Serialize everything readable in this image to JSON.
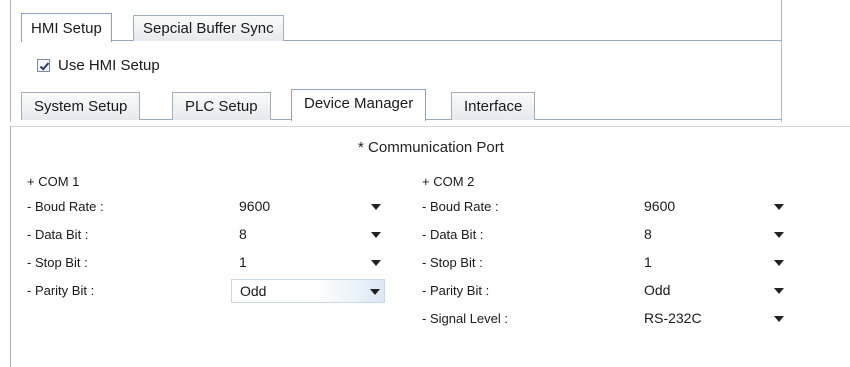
{
  "outer_tabs": [
    {
      "label": "HMI Setup",
      "active": true
    },
    {
      "label": "Sepcial Buffer Sync",
      "active": false
    }
  ],
  "use_hmi_setup": {
    "label": "Use HMI Setup",
    "checked": true
  },
  "inner_tabs": [
    {
      "label": "System Setup",
      "active": false
    },
    {
      "label": "PLC Setup",
      "active": false
    },
    {
      "label": "Device Manager",
      "active": true
    },
    {
      "label": "Interface",
      "active": false
    }
  ],
  "comm_port": {
    "title": "* Communication Port",
    "com1": {
      "header": "+ COM 1",
      "fields": [
        {
          "label": "- Boud Rate :",
          "value": "9600"
        },
        {
          "label": "- Data Bit :",
          "value": "8"
        },
        {
          "label": "- Stop Bit :",
          "value": "1"
        },
        {
          "label": "- Parity Bit :",
          "value": "Odd"
        }
      ]
    },
    "com2": {
      "header": "+ COM 2",
      "fields": [
        {
          "label": "- Boud Rate :",
          "value": "9600"
        },
        {
          "label": "- Data Bit :",
          "value": "8"
        },
        {
          "label": "- Stop Bit :",
          "value": "1"
        },
        {
          "label": "- Parity Bit :",
          "value": "Odd"
        },
        {
          "label": "- Signal Level :",
          "value": "RS-232C"
        }
      ]
    }
  },
  "colors": {
    "tab_border": "#a3aebb",
    "focus_gradient": "#dce8f4",
    "panel_border": "#b3b3b3"
  },
  "icons": {
    "checkbox": "checkmark-icon",
    "dropdown": "chevron-down-icon"
  }
}
